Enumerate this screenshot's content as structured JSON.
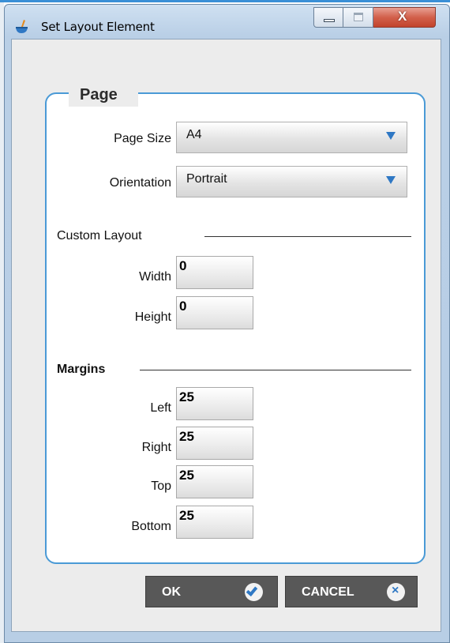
{
  "window": {
    "title": "Set Layout Element",
    "controls": {
      "minimize": "minimize",
      "maximize": "maximize",
      "close": "X"
    },
    "accent_color": "#4a9ad6"
  },
  "group": {
    "title": "Page",
    "page_size": {
      "label": "Page Size",
      "value": "A4"
    },
    "orientation": {
      "label": "Orientation",
      "value": "Portrait"
    },
    "custom_layout": {
      "heading": "Custom Layout",
      "width": {
        "label": "Width",
        "value": "0"
      },
      "height": {
        "label": "Height",
        "value": "0"
      }
    },
    "margins": {
      "heading": "Margins",
      "left": {
        "label": "Left",
        "value": "25"
      },
      "right": {
        "label": "Right",
        "value": "25"
      },
      "top": {
        "label": "Top",
        "value": "25"
      },
      "bottom": {
        "label": "Bottom",
        "value": "25"
      }
    }
  },
  "buttons": {
    "ok": {
      "label": "OK",
      "icon": "checkmark-icon"
    },
    "cancel": {
      "label": "CANCEL",
      "icon": "close-circle-icon"
    }
  }
}
